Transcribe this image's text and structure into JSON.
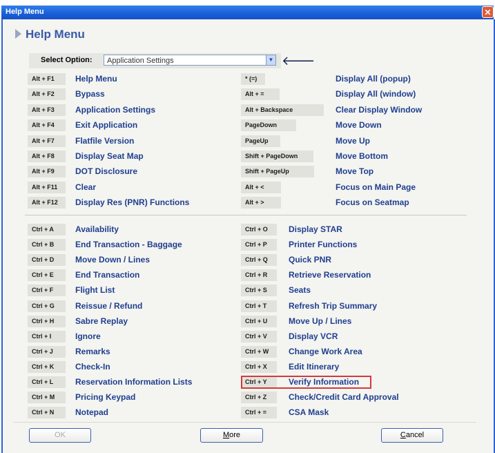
{
  "window": {
    "title": "Help Menu",
    "close_glyph": "✕"
  },
  "header": {
    "title": "Help Menu"
  },
  "select": {
    "label": "Select Option:",
    "value": "Application Settings"
  },
  "alt_left": [
    {
      "key": "Alt + F1",
      "desc": "Help Menu"
    },
    {
      "key": "Alt + F2",
      "desc": "Bypass"
    },
    {
      "key": "Alt + F3",
      "desc": "Application Settings"
    },
    {
      "key": "Alt + F4",
      "desc": "Exit Application"
    },
    {
      "key": "Alt + F7",
      "desc": "Flatfile Version"
    },
    {
      "key": "Alt + F8",
      "desc": "Display Seat Map"
    },
    {
      "key": "Alt + F9",
      "desc": "DOT Disclosure"
    },
    {
      "key": "Alt + F11",
      "desc": "Clear"
    },
    {
      "key": "Alt + F12",
      "desc": "Display Res (PNR) Functions"
    }
  ],
  "alt_right": [
    {
      "key": "* (=)",
      "desc": "Display All (popup)"
    },
    {
      "key": "Alt + =",
      "desc": "Display All (window)"
    },
    {
      "key": "Alt + Backspace",
      "desc": "Clear Display Window"
    },
    {
      "key": "PageDown",
      "desc": "Move Down"
    },
    {
      "key": "PageUp",
      "desc": "Move Up"
    },
    {
      "key": "Shift + PageDown",
      "desc": "Move Bottom"
    },
    {
      "key": "Shift + PageUp",
      "desc": "Move Top"
    },
    {
      "key": "Alt + <",
      "desc": "Focus on Main Page"
    },
    {
      "key": "Alt + >",
      "desc": "Focus on Seatmap"
    }
  ],
  "ctrl_left": [
    {
      "key": "Ctrl + A",
      "desc": "Availability"
    },
    {
      "key": "Ctrl + B",
      "desc": "End Transaction - Baggage"
    },
    {
      "key": "Ctrl + D",
      "desc": "Move Down / Lines"
    },
    {
      "key": "Ctrl + E",
      "desc": "End Transaction"
    },
    {
      "key": "Ctrl + F",
      "desc": "Flight List"
    },
    {
      "key": "Ctrl + G",
      "desc": "Reissue / Refund"
    },
    {
      "key": "Ctrl + H",
      "desc": "Sabre Replay"
    },
    {
      "key": "Ctrl + I",
      "desc": "Ignore"
    },
    {
      "key": "Ctrl + J",
      "desc": "Remarks"
    },
    {
      "key": "Ctrl + K",
      "desc": "Check-In"
    },
    {
      "key": "Ctrl + L",
      "desc": "Reservation Information Lists"
    },
    {
      "key": "Ctrl + M",
      "desc": "Pricing Keypad"
    },
    {
      "key": "Ctrl + N",
      "desc": "Notepad"
    }
  ],
  "ctrl_right": [
    {
      "key": "Ctrl + O",
      "desc": "Display STAR"
    },
    {
      "key": "Ctrl + P",
      "desc": "Printer Functions"
    },
    {
      "key": "Ctrl + Q",
      "desc": "Quick PNR"
    },
    {
      "key": "Ctrl + R",
      "desc": "Retrieve Reservation"
    },
    {
      "key": "Ctrl + S",
      "desc": "Seats"
    },
    {
      "key": "Ctrl + T",
      "desc": "Refresh Trip Summary"
    },
    {
      "key": "Ctrl + U",
      "desc": "Move Up / Lines"
    },
    {
      "key": "Ctrl + V",
      "desc": "Display VCR"
    },
    {
      "key": "Ctrl + W",
      "desc": "Change Work Area"
    },
    {
      "key": "Ctrl + X",
      "desc": "Edit Itinerary"
    },
    {
      "key": "Ctrl + Y",
      "desc": "Verify Information",
      "highlighted": true
    },
    {
      "key": "Ctrl + Z",
      "desc": "Check/Credit Card Approval"
    },
    {
      "key": "Ctrl + =",
      "desc": "CSA Mask"
    }
  ],
  "buttons": {
    "ok": "OK",
    "more_first": "M",
    "more_rest": "ore",
    "cancel_first": "C",
    "cancel_rest": "ancel"
  },
  "colors": {
    "title_bar": "#1a5fd8",
    "link_text": "#1f3f8f",
    "highlight": "#d23a3a"
  }
}
